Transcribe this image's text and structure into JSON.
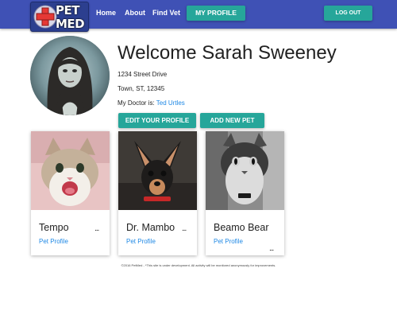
{
  "navbar": {
    "logo": {
      "line1": "PET",
      "line2": "MED"
    },
    "links": {
      "home": "Home",
      "about": "About",
      "find_vet": "Find Vet"
    },
    "my_profile": "MY PROFILE",
    "logout": "LOG OUT"
  },
  "colors": {
    "primary": "#3f51b5",
    "accent": "#26a69a",
    "link": "#1e88e5"
  },
  "profile": {
    "welcome": "Welcome Sarah Sweeney",
    "street": "1234 Street Drive",
    "town": "Town, ST, 12345",
    "doctor_label": "My Doctor is:",
    "doctor_name": "Ted Urtles",
    "edit_button": "EDIT YOUR PROFILE",
    "add_pet_button": "ADD NEW PET"
  },
  "pets": [
    {
      "name": "Tempo",
      "link": "Pet Profile",
      "menu": "..."
    },
    {
      "name": "Dr. Mambo",
      "link": "Pet Profile",
      "menu": "..."
    },
    {
      "name": "Beamo Bear",
      "link": "Pet Profile",
      "menu": "..."
    }
  ],
  "footer": "©2016 PetMed - *This site is under development. All activity will be monitored anonymously for improvements."
}
